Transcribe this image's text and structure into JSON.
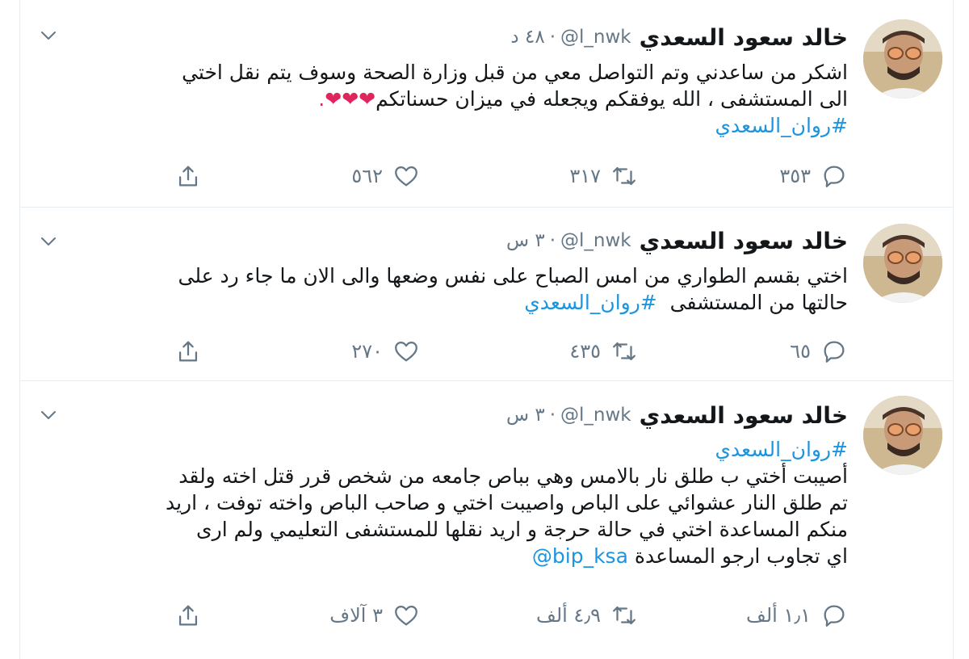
{
  "tweets": [
    {
      "author": {
        "name": "خالد سعود السعدي",
        "handle": "@l_nwk"
      },
      "separator": "·",
      "time": "٤٨ د",
      "lines": [
        "اشكر من ساعدني وتم التواصل معي من قبل وزارة الصحة وسوف يتم نقل اختي",
        "الى المستشفى ، الله يوفقكم ويجعله في ميزان حسناتكم"
      ],
      "emoji": "❤❤❤.",
      "hashtag": "#روان_السعدي",
      "stats": {
        "replies": "٣٥٣",
        "retweets": "٣١٧",
        "likes": "٥٦٢"
      }
    },
    {
      "author": {
        "name": "خالد سعود السعدي",
        "handle": "@l_nwk"
      },
      "separator": "·",
      "time": "٣ س",
      "lines": [
        "اختي بقسم الطواري من امس الصباح على نفس وضعها والى الان ما جاء رد على",
        "حالتها من المستشفى"
      ],
      "hashtag": "#روان_السعدي",
      "stats": {
        "replies": "٦٥",
        "retweets": "٤٣٥",
        "likes": "٢٧٠"
      }
    },
    {
      "author": {
        "name": "خالد سعود السعدي",
        "handle": "@l_nwk"
      },
      "separator": "·",
      "time": "٣ س",
      "hashtag": "#روان_السعدي",
      "lines": [
        "أصيبت أختي ب طلق نار بالامس وهي بباص جامعه من شخص قرر قتل اخته ولقد",
        "تم طلق النار عشوائي على الباص واصيبت اختي و صاحب الباص واخته توفت ، اريد",
        "منكم المساعدة اختي في حالة حرجة و اريد نقلها للمستشفى التعليمي ولم ارى",
        "اي تجاوب ارجو المساعدة"
      ],
      "mention": "@bip_ksa",
      "stats": {
        "replies": "١٫١ ألف",
        "retweets": "٤٫٩ ألف",
        "likes": "٣ آلاف"
      }
    }
  ],
  "colors": {
    "text": "#14171a",
    "muted": "#657786",
    "link": "#1b95e0",
    "divider": "#e6ecf0",
    "heart": "#e0245e"
  },
  "icons": [
    "reply-icon",
    "retweet-icon",
    "like-icon",
    "share-icon",
    "chevron-down-icon"
  ]
}
